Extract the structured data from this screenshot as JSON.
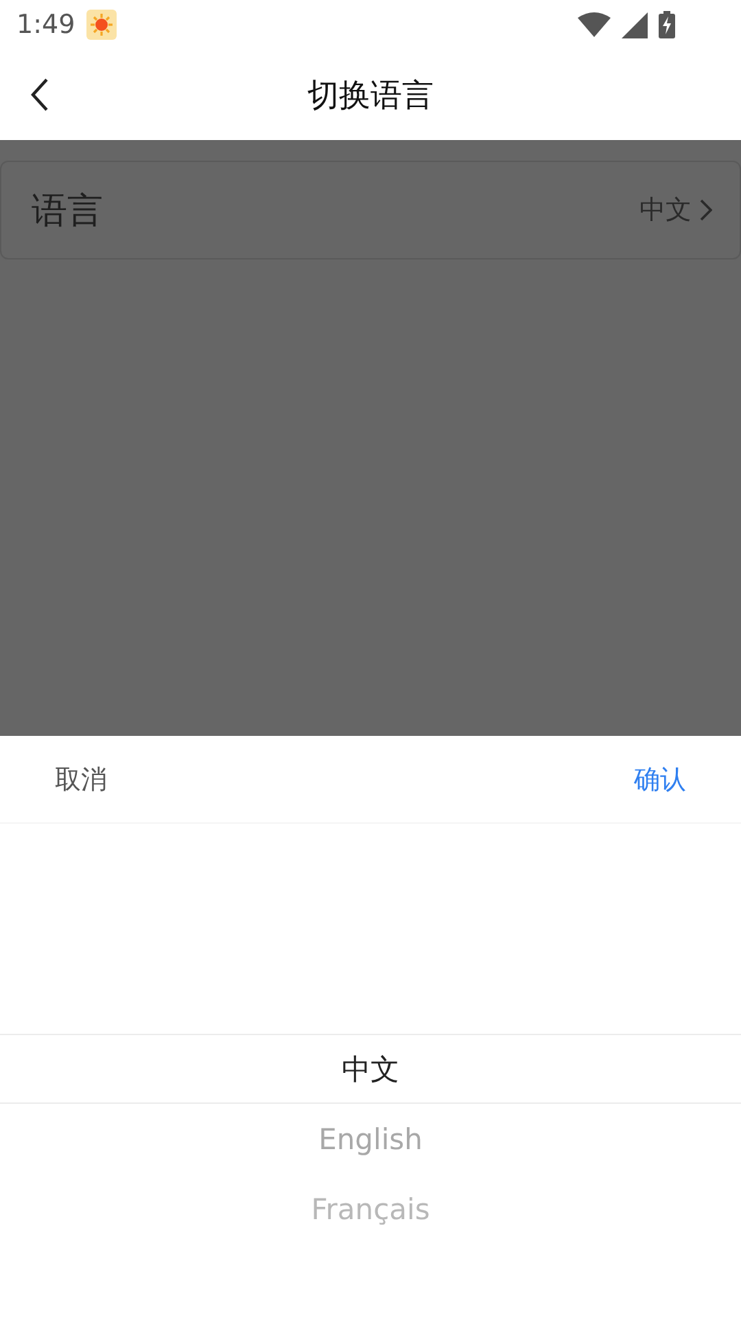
{
  "status_bar": {
    "time": "1:49"
  },
  "header": {
    "title": "切换语言"
  },
  "settings": [
    {
      "label": "语言",
      "value": "中文"
    }
  ],
  "sheet": {
    "cancel": "取消",
    "confirm": "确认",
    "options": [
      {
        "label": "中文",
        "selected": true
      },
      {
        "label": "English",
        "selected": false
      },
      {
        "label": "Français",
        "selected": false
      }
    ]
  }
}
